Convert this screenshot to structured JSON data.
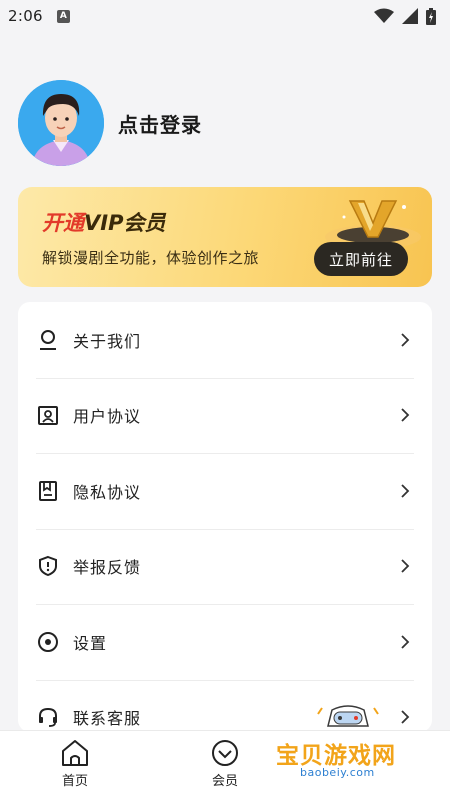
{
  "status_bar": {
    "time": "2:06",
    "a_badge": "A"
  },
  "profile": {
    "login_label": "点击登录"
  },
  "vip": {
    "title_prefix": "开通",
    "title_suffix": "VIP会员",
    "subtitle": "解锁漫剧全功能，体验创作之旅",
    "button_label": "立即前往"
  },
  "menu": {
    "items": [
      {
        "label": "关于我们",
        "icon": "user-outline-icon"
      },
      {
        "label": "用户协议",
        "icon": "id-badge-icon"
      },
      {
        "label": "隐私协议",
        "icon": "bookmark-book-icon"
      },
      {
        "label": "举报反馈",
        "icon": "shield-alert-icon"
      },
      {
        "label": "设置",
        "icon": "settings-circle-icon"
      },
      {
        "label": "联系客服",
        "icon": "headset-icon"
      }
    ]
  },
  "nav": {
    "items": [
      {
        "label": "首页",
        "icon": "home-icon"
      },
      {
        "label": "会员",
        "icon": "diamond-icon"
      }
    ]
  },
  "watermark": {
    "name": "宝贝游戏网",
    "url": "baobeiy.com"
  },
  "colors": {
    "vip_red": "#e23a2a",
    "vip_button": "#2b2822",
    "avatar_bg": "#3aa9ee",
    "watermark": "#f2a41a"
  }
}
